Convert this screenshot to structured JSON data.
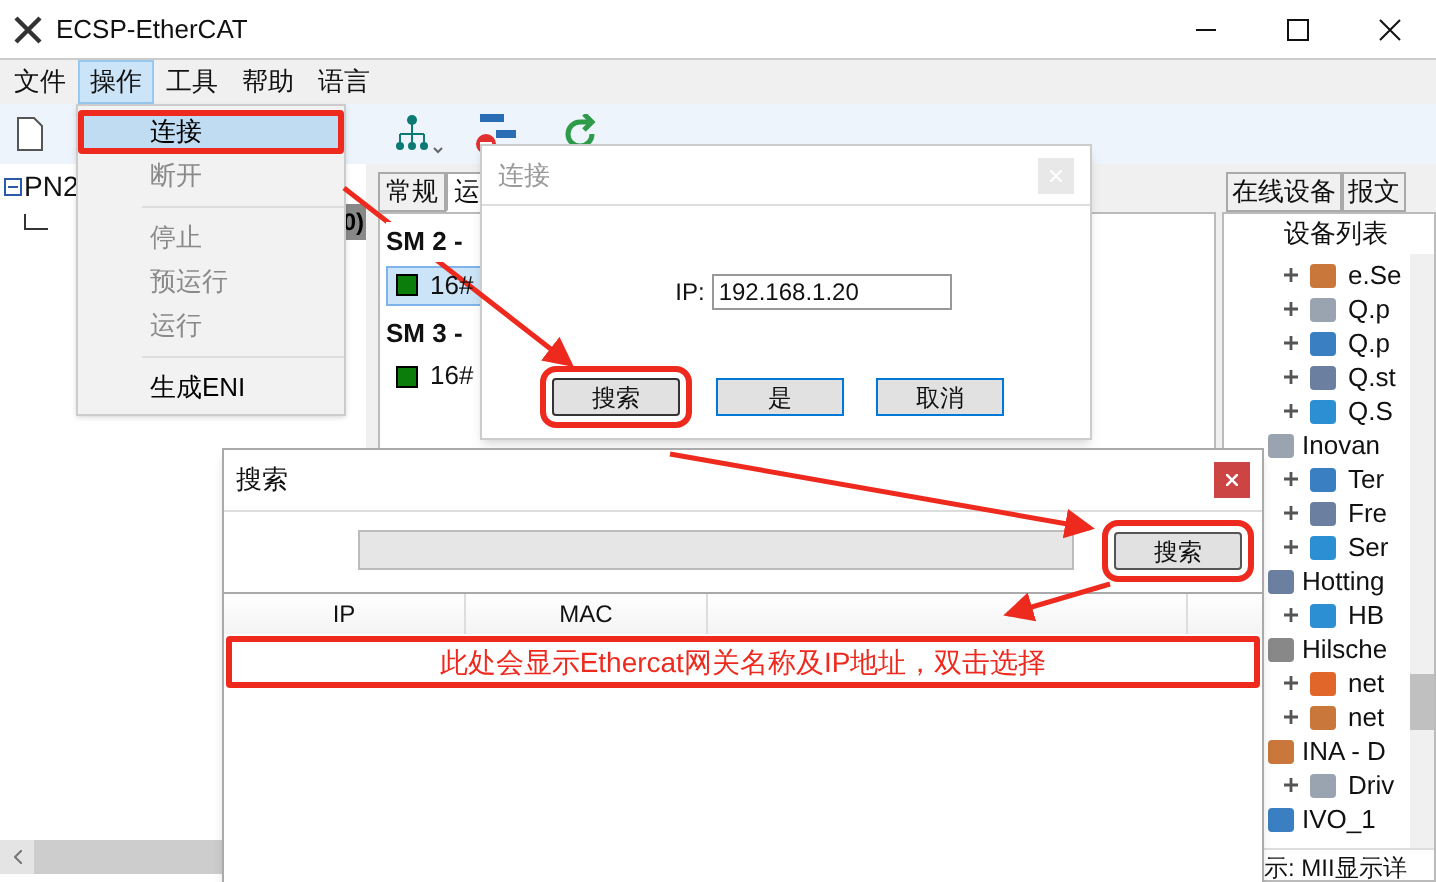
{
  "window": {
    "title": "ECSP-EtherCAT"
  },
  "menu_bar": [
    {
      "label": "文件",
      "selected": false
    },
    {
      "label": "操作",
      "selected": true
    },
    {
      "label": "工具",
      "selected": false
    },
    {
      "label": "帮助",
      "selected": false
    },
    {
      "label": "语言",
      "selected": false
    }
  ],
  "operations_menu": [
    {
      "label": "连接",
      "selected": true,
      "disabled": false,
      "highlighted": true
    },
    {
      "label": "断开",
      "selected": false,
      "disabled": true,
      "highlighted": false
    },
    {
      "label": "停止",
      "selected": false,
      "disabled": true,
      "highlighted": false
    },
    {
      "label": "预运行",
      "selected": false,
      "disabled": true,
      "highlighted": false
    },
    {
      "label": "运行",
      "selected": false,
      "disabled": true,
      "highlighted": false
    },
    {
      "label": "生成ENI",
      "selected": false,
      "disabled": false,
      "highlighted": false
    }
  ],
  "project_tree": {
    "label": "PN2",
    "expanded": true,
    "child_text": "0)"
  },
  "detail_tabs": [
    {
      "label": "常规",
      "selected": false
    },
    {
      "label": "运",
      "selected": true
    }
  ],
  "sync_managers": [
    {
      "title": "SM 2 -",
      "entries": [
        {
          "label": "16#",
          "selected": true
        }
      ]
    },
    {
      "title": "SM 3 -",
      "entries": [
        {
          "label": "16#",
          "selected": false
        }
      ]
    }
  ],
  "device_panel": {
    "tabs": [
      {
        "label": "在线设备",
        "selected": false
      },
      {
        "label": "报文",
        "selected": false
      }
    ],
    "column_header": "设备列表",
    "tree": [
      {
        "children": [
          {
            "label": "e.Se"
          },
          {
            "label": "Q.p"
          },
          {
            "label": "Q.p"
          },
          {
            "label": "Q.st"
          },
          {
            "label": "Q.S"
          }
        ]
      },
      {
        "label": "Inovan",
        "children": [
          {
            "label": "Ter"
          },
          {
            "label": "Fre"
          },
          {
            "label": "Ser"
          }
        ]
      },
      {
        "label": "Hotting",
        "children": [
          {
            "label": "HB"
          }
        ]
      },
      {
        "label": "Hilsche",
        "children": [
          {
            "label": "net"
          },
          {
            "label": "net"
          }
        ]
      },
      {
        "label": "INA - D",
        "children": [
          {
            "label": "Driv"
          }
        ]
      },
      {
        "label": "IVO_1"
      }
    ],
    "status_text": "示: MII显示详"
  },
  "connect_dialog": {
    "title": "连接",
    "ip_label": "IP:",
    "ip_value": "192.168.1.20",
    "buttons": [
      {
        "label": "搜索",
        "highlighted": true
      },
      {
        "label": "是",
        "highlighted": false
      },
      {
        "label": "取消",
        "highlighted": false
      }
    ]
  },
  "search_dialog": {
    "title": "搜索",
    "progress": {
      "level": 0
    },
    "search_button": {
      "label": "搜索",
      "highlighted": true
    },
    "columns": [
      "IP",
      "MAC"
    ],
    "annotation": "此处会显示Ethercat网关名称及IP地址，双击选择"
  }
}
